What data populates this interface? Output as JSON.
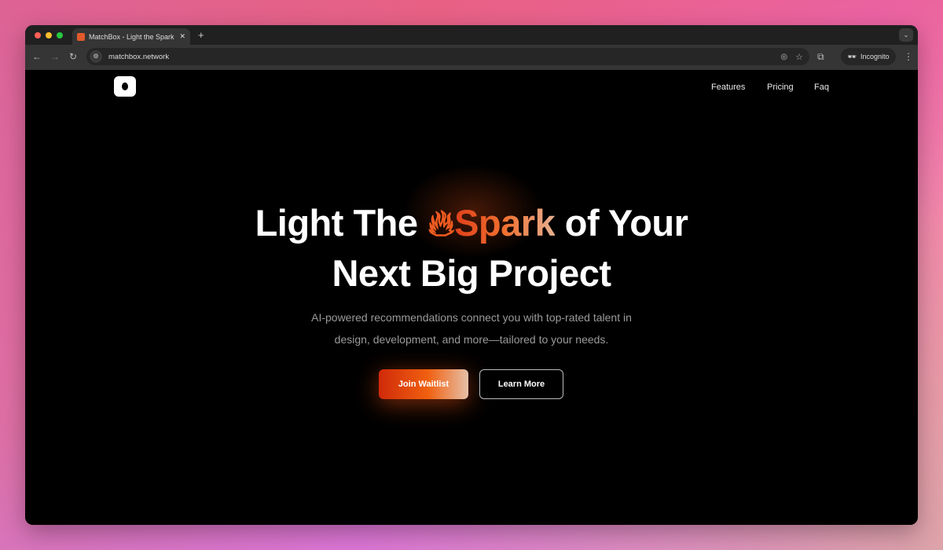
{
  "browser": {
    "tab_title": "MatchBox - Light the Spark of Your Next Big Project",
    "url": "matchbox.network",
    "incognito_label": "Incognito"
  },
  "nav": {
    "items": [
      "Features",
      "Pricing",
      "Faq"
    ]
  },
  "hero": {
    "title_pre": "Light The ",
    "title_highlight": "Spark",
    "title_post": " of Your",
    "title_line2": "Next Big Project",
    "subtitle_line1": "AI-powered recommendations connect you with top-rated talent in",
    "subtitle_line2": "design, development, and more—tailored to your needs.",
    "primary_button": "Join Waitlist",
    "secondary_button": "Learn More"
  },
  "colors": {
    "accent": "#ef5a20",
    "background": "#000000"
  }
}
